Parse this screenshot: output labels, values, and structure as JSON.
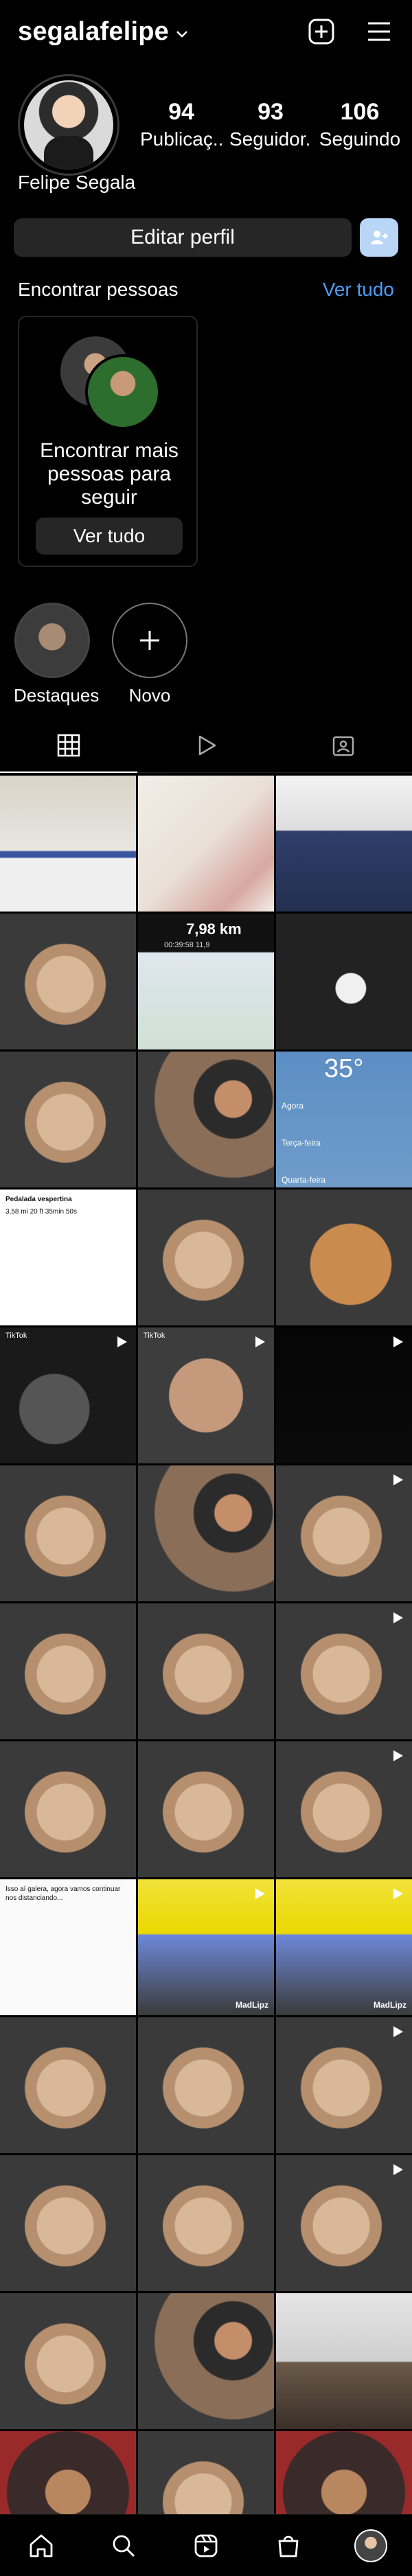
{
  "header": {
    "username": "segalafelipe"
  },
  "profile": {
    "full_name": "Felipe Segala",
    "stats": [
      {
        "value": "94",
        "label": "Publicaç..."
      },
      {
        "value": "93",
        "label": "Seguidor..."
      },
      {
        "value": "106",
        "label": "Seguindo"
      }
    ]
  },
  "actions": {
    "edit_profile": "Editar perfil"
  },
  "discover": {
    "title": "Encontrar pessoas",
    "see_all": "Ver tudo",
    "card_text": "Encontrar mais pessoas para seguir",
    "card_button": "Ver tudo"
  },
  "highlights": [
    {
      "label": "Destaques"
    },
    {
      "label": "Novo"
    }
  ],
  "grid": {
    "posts": [
      {
        "kind": "cake"
      },
      {
        "kind": "invitation"
      },
      {
        "kind": "family"
      },
      {
        "kind": "dog"
      },
      {
        "kind": "map",
        "distance": "7,98",
        "unit": "km",
        "time": "00:39:58",
        "pace": "11,9"
      },
      {
        "kind": "keychain"
      },
      {
        "kind": "dog"
      },
      {
        "kind": "selfie"
      },
      {
        "kind": "weather",
        "temp": "35°",
        "days": [
          "Agora",
          "Terça-feira",
          "Quarta-feira"
        ]
      },
      {
        "kind": "chart-post",
        "title": "Pedalada vespertina",
        "line1": "3,58 mi  20 ft  35min 50s"
      },
      {
        "kind": "dog"
      },
      {
        "kind": "bread"
      },
      {
        "kind": "car",
        "tiktok": "TikTok"
      },
      {
        "kind": "face",
        "tiktok": "TikTok"
      },
      {
        "kind": "dark"
      },
      {
        "kind": "dog"
      },
      {
        "kind": "selfie"
      },
      {
        "kind": "dog"
      },
      {
        "kind": "dog"
      },
      {
        "kind": "dog"
      },
      {
        "kind": "dog"
      },
      {
        "kind": "dog"
      },
      {
        "kind": "dog"
      },
      {
        "kind": "dog"
      },
      {
        "kind": "text-post",
        "text": "Isso aí galera, agora vamos continuar nos distanciando..."
      },
      {
        "kind": "meme",
        "watermark": "MadLipz"
      },
      {
        "kind": "meme",
        "watermark": "MadLipz"
      },
      {
        "kind": "dog"
      },
      {
        "kind": "dog"
      },
      {
        "kind": "dog"
      },
      {
        "kind": "dog"
      },
      {
        "kind": "dog"
      },
      {
        "kind": "dog"
      },
      {
        "kind": "dog"
      },
      {
        "kind": "selfie"
      },
      {
        "kind": "desk"
      },
      {
        "kind": "person"
      },
      {
        "kind": "dog"
      },
      {
        "kind": "person"
      }
    ]
  },
  "colors": {
    "background": "#000000",
    "link": "#4d9df7",
    "button_bg": "#262626",
    "add_user_bg": "#b9d6f7"
  },
  "icons": {
    "top": [
      "chevron-down-icon",
      "add-icon",
      "menu-icon"
    ],
    "tabs": [
      "grid-icon",
      "reels-icon",
      "tagged-icon"
    ],
    "nav": [
      "home-icon",
      "search-icon",
      "reels-icon",
      "shop-icon",
      "profile-avatar"
    ]
  }
}
